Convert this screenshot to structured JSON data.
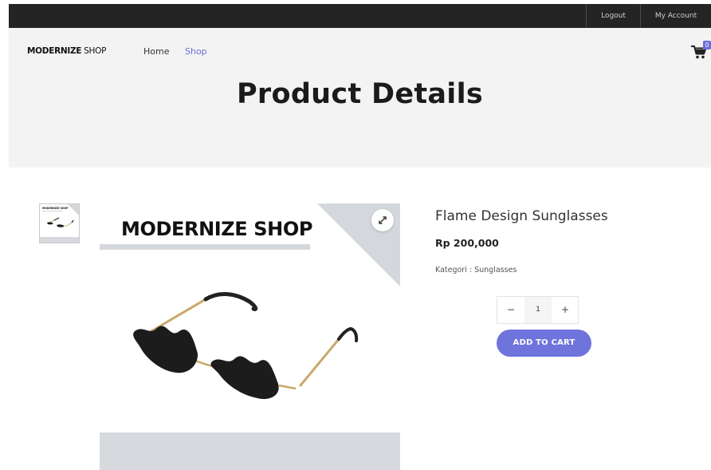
{
  "topbar": {
    "logout_label": "Logout",
    "account_label": "My Account"
  },
  "header": {
    "logo_bold": "MODERNIZE",
    "logo_rest": " SHOP",
    "nav": [
      {
        "label": "Home",
        "active": false
      },
      {
        "label": "Shop",
        "active": true
      }
    ],
    "cart_count": "0",
    "page_title": "Product Details"
  },
  "product": {
    "image_brand_text": "MODERNIZE SHOP",
    "thumb_brand_text": "MODERNIZE SHOP",
    "name": "Flame Design Sunglasses",
    "price": "Rp 200,000",
    "category": "Kategori : Sunglasses",
    "quantity": "1",
    "minus_symbol": "−",
    "plus_symbol": "+",
    "add_to_cart_label": "ADD TO CART"
  },
  "icons": {
    "cart": "cart-icon",
    "expand": "expand-icon"
  },
  "colors": {
    "accent": "#6a6ed8",
    "topbar": "#242424",
    "hero_bg": "#f3f3f3",
    "image_gray": "#d4d8dc"
  }
}
